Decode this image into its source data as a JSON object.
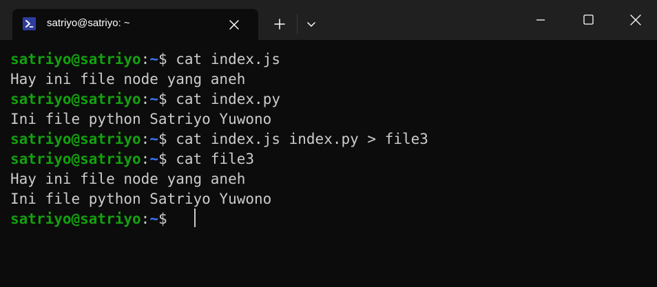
{
  "window": {
    "tab_title": "satriyo@satriyo: ~"
  },
  "icons": {
    "tab": "powershell-icon",
    "tab_close": "close-icon",
    "new_tab": "plus-icon",
    "dropdown": "chevron-down-icon",
    "minimize": "minimize-icon",
    "maximize": "maximize-icon",
    "close": "close-icon"
  },
  "colors": {
    "prompt_user": "#13a10e",
    "prompt_path": "#3b78ff",
    "text": "#cccccc",
    "background": "#0c0c0c",
    "titlebar": "#202020"
  },
  "terminal": {
    "lines": [
      {
        "user": "satriyo@satriyo",
        "sep": ":",
        "path": "~",
        "sym": "$",
        "cmd": " cat index.js"
      },
      {
        "text": "Hay ini file node yang aneh"
      },
      {
        "user": "satriyo@satriyo",
        "sep": ":",
        "path": "~",
        "sym": "$",
        "cmd": " cat index.py"
      },
      {
        "text": "Ini file python Satriyo Yuwono"
      },
      {
        "user": "satriyo@satriyo",
        "sep": ":",
        "path": "~",
        "sym": "$",
        "cmd": " cat index.js index.py > file3"
      },
      {
        "user": "satriyo@satriyo",
        "sep": ":",
        "path": "~",
        "sym": "$",
        "cmd": " cat file3"
      },
      {
        "text": "Hay ini file node yang aneh"
      },
      {
        "text": "Ini file python Satriyo Yuwono"
      },
      {
        "user": "satriyo@satriyo",
        "sep": ":",
        "path": "~",
        "sym": "$",
        "cmd": " "
      }
    ]
  }
}
